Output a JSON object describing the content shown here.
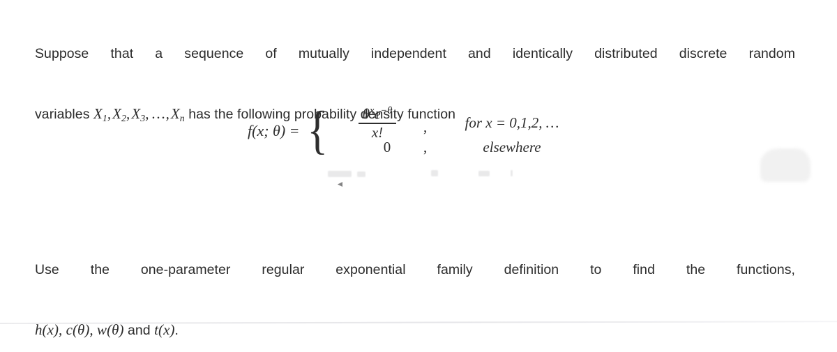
{
  "document": {
    "background_color": "#ffffff",
    "text_color": "#2b2b2b",
    "problem": {
      "intro_line_1": "Suppose that a sequence of mutually independent and identically distributed discrete random",
      "intro_line_2_prefix": "variables ",
      "intro_line_2_suffix": " has the following probability density function",
      "variables_list": "X₁, X₂, X₃, … , Xₙ",
      "instruction_line_1": "Use the one-parameter regular exponential family definition to find the functions,",
      "instruction_line_2_math": "h(x), c(θ), w(θ)",
      "instruction_line_2_conjunction": " and ",
      "instruction_line_2_math_tail": "t(x)",
      "instruction_line_2_period": "."
    },
    "equation": {
      "lhs": "f(x; θ)  =",
      "brace": "{",
      "case_1": {
        "numerator_base": "θ",
        "numerator_exponent": "x",
        "numerator_e": "e",
        "numerator_e_exponent": "−θ",
        "denominator": "x!",
        "separator": ",",
        "condition": "for x = 0,1,2, …"
      },
      "case_2": {
        "value": "0",
        "separator": ",",
        "condition": "elsewhere"
      },
      "plain_text": "f(x;θ) = { θ^x e^(−θ) / x! , for x = 0,1,2,... ; 0, elsewhere }"
    },
    "artifacts": {
      "smudge_color": "#f1f1f1",
      "rule_color": "#e9e9ec"
    }
  }
}
